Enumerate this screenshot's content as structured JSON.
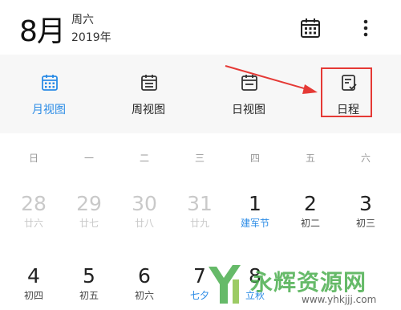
{
  "header": {
    "month": "8月",
    "weekday": "周六",
    "year": "2019年"
  },
  "tabs": [
    {
      "label": "月视图",
      "icon": "calendar-month-icon",
      "active": true
    },
    {
      "label": "周视图",
      "icon": "calendar-week-icon",
      "active": false
    },
    {
      "label": "日视图",
      "icon": "calendar-day-icon",
      "active": false
    },
    {
      "label": "日程",
      "icon": "schedule-icon",
      "active": false
    }
  ],
  "week_headers": [
    "日",
    "一",
    "二",
    "三",
    "四",
    "五",
    "六"
  ],
  "days": [
    {
      "num": "28",
      "sub": "廿六"
    },
    {
      "num": "29",
      "sub": "廿七"
    },
    {
      "num": "30",
      "sub": "廿八"
    },
    {
      "num": "31",
      "sub": "廿九"
    },
    {
      "num": "1",
      "sub": "建军节"
    },
    {
      "num": "2",
      "sub": "初二"
    },
    {
      "num": "3",
      "sub": "初三"
    },
    {
      "num": "4",
      "sub": "初四"
    },
    {
      "num": "5",
      "sub": "初五"
    },
    {
      "num": "6",
      "sub": "初六"
    },
    {
      "num": "7",
      "sub": "七夕"
    },
    {
      "num": "8",
      "sub": "立秋"
    }
  ],
  "watermark": {
    "text": "永辉资源网",
    "url": "www.yhkjjj.com"
  },
  "colors": {
    "accent": "#2a8be6",
    "annotation_red": "#e53935",
    "faded": "#c9c9c9",
    "watermark_green": "#4caf50"
  }
}
